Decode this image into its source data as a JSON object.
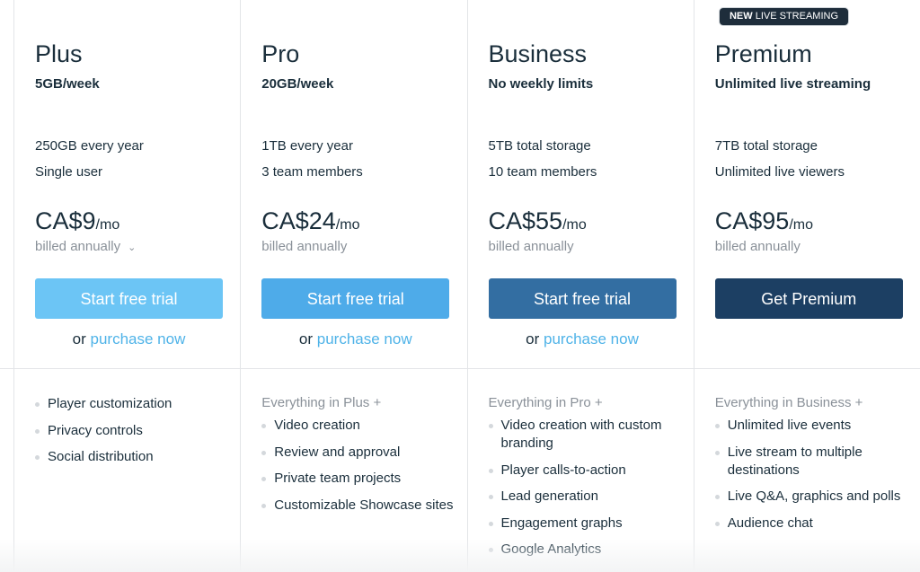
{
  "badge": {
    "strong": "NEW",
    "text": " LIVE STREAMING"
  },
  "plans": [
    {
      "name": "Plus",
      "subtitle": "5GB/week",
      "specs": [
        "250GB every year",
        "Single user"
      ],
      "price": "CA$9",
      "per": "/mo",
      "billing": "billed annually",
      "billing_has_dropdown": true,
      "button": "Start free trial",
      "button_color": "#6cc5f5",
      "or_text": "or ",
      "purchase_link": "purchase now",
      "features_lead": "",
      "features": [
        "Player customization",
        "Privacy controls",
        "Social distribution"
      ]
    },
    {
      "name": "Pro",
      "subtitle": "20GB/week",
      "specs": [
        "1TB every year",
        "3 team members"
      ],
      "price": "CA$24",
      "per": "/mo",
      "billing": "billed annually",
      "button": "Start free trial",
      "button_color": "#4eabe9",
      "or_text": "or ",
      "purchase_link": "purchase now",
      "features_lead": "Everything in Plus +",
      "features": [
        "Video creation",
        "Review and approval",
        "Private team projects",
        "Customizable Showcase sites"
      ]
    },
    {
      "name": "Business",
      "subtitle": "No weekly limits",
      "specs": [
        "5TB total storage",
        "10 team members"
      ],
      "price": "CA$55",
      "per": "/mo",
      "billing": "billed annually",
      "button": "Start free trial",
      "button_color": "#336ea2",
      "or_text": "or ",
      "purchase_link": "purchase now",
      "features_lead": "Everything in Pro +",
      "features": [
        "Video creation with custom branding",
        "Player calls-to-action",
        "Lead generation",
        "Engagement graphs",
        "Google Analytics"
      ]
    },
    {
      "name": "Premium",
      "subtitle": "Unlimited live streaming",
      "specs": [
        "7TB total storage",
        "Unlimited live viewers"
      ],
      "price": "CA$95",
      "per": "/mo",
      "billing": "billed annually",
      "button": "Get Premium",
      "button_color": "#1c3f63",
      "features_lead": "Everything in Business +",
      "features": [
        "Unlimited live events",
        "Live stream to multiple destinations",
        "Live Q&A, graphics and polls",
        "Audience chat"
      ]
    }
  ]
}
